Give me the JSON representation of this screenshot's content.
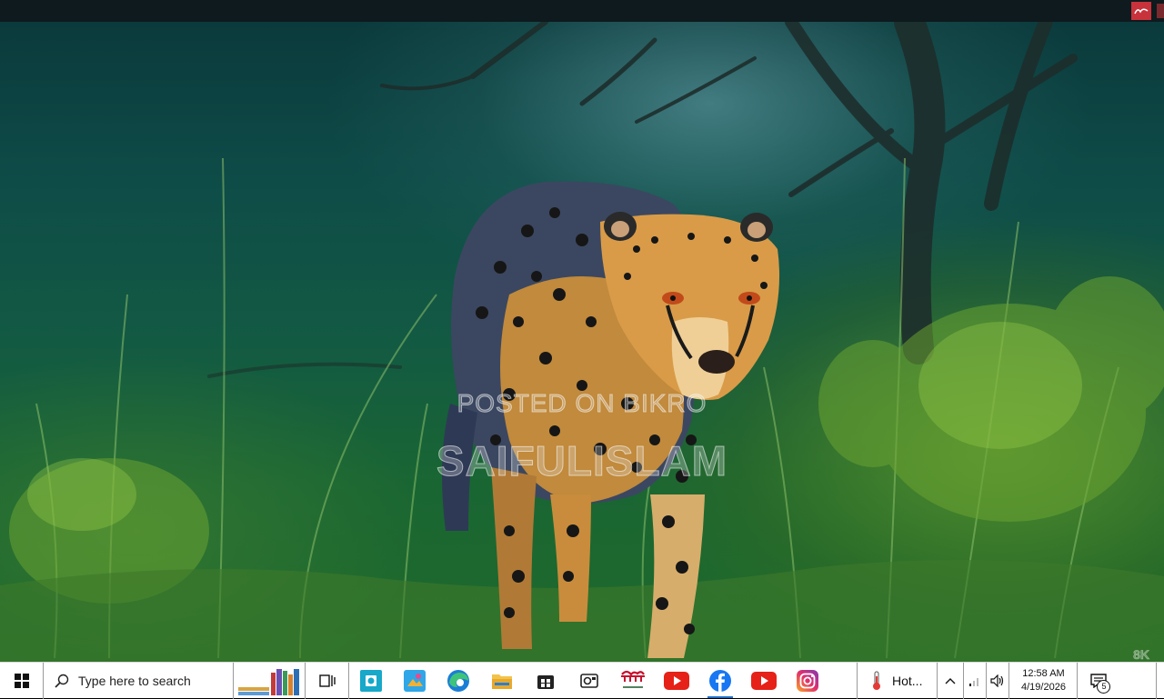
{
  "taskbar": {
    "search_placeholder": "Type here to search",
    "weather_label": "Hot...",
    "clock_time": "12:58 AM",
    "clock_date": "4/19/2026",
    "notification_count": "5",
    "pinned_apps": [
      "camera-app-icon",
      "photos-app-icon",
      "edge-browser-icon",
      "file-explorer-icon",
      "store-app-icon",
      "office-app-icon",
      "bengali-logo-app-icon",
      "youtube-icon",
      "facebook-icon",
      "youtube-icon",
      "instagram-icon"
    ],
    "accent": "#1f6fc9"
  },
  "wallpaper": {
    "subject": "cheetah in grass",
    "watermark_line1": "POSTED ON BIKRO",
    "watermark_line2": "SAIFULISLAM",
    "resolution_mark": "8K"
  },
  "colors": {
    "topbar": "#0e1a1e",
    "badge": "#c7323b",
    "taskbar": "#ffffff"
  }
}
